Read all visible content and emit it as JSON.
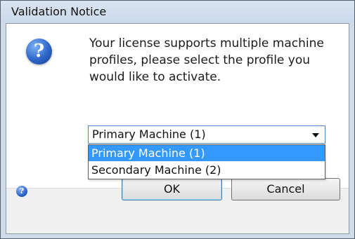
{
  "window": {
    "title": "Validation Notice"
  },
  "icons": {
    "question": "question-mark-icon",
    "help": "help-icon"
  },
  "message": "Your license supports multiple machine profiles,  please select the profile you would like to activate.",
  "dropdown": {
    "selected": "Primary Machine (1)",
    "options": [
      "Primary Machine (1)",
      "Secondary Machine (2)"
    ],
    "highlighted_index": 0
  },
  "buttons": {
    "ok": "OK",
    "cancel": "Cancel"
  },
  "colors": {
    "highlight": "#3399ff",
    "dropdown_border": "#4f87c5"
  }
}
